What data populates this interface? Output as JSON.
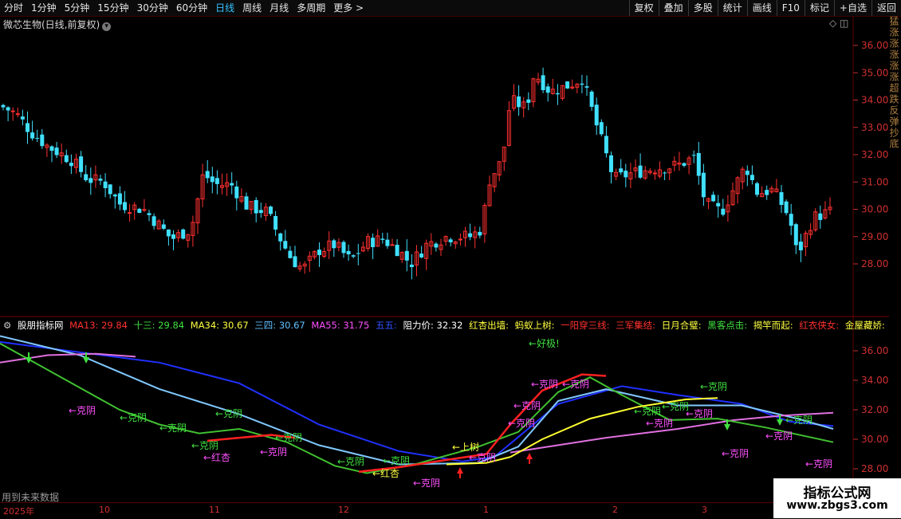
{
  "toolbar": {
    "periods": [
      "分时",
      "1分钟",
      "5分钟",
      "15分钟",
      "30分钟",
      "60分钟",
      "日线",
      "周线",
      "月线",
      "多周期",
      "更多 >"
    ],
    "active": "日线",
    "right_buttons": [
      "复权",
      "叠加",
      "多股",
      "统计",
      "画线",
      "F10",
      "标记",
      "+自选",
      "返回"
    ]
  },
  "stock_title": "微芯生物(日线,前复权)",
  "top_tools": "◇ ◫",
  "price_axis": [
    "36.00",
    "35.00",
    "34.00",
    "33.00",
    "32.00",
    "31.00",
    "30.00",
    "29.00",
    "28.00"
  ],
  "ind_axis": [
    "36.00",
    "34.00",
    "32.00",
    "30.00",
    "28.00"
  ],
  "indicator_legend": {
    "name": "股朋指标网",
    "items": [
      {
        "text": "MA13: 29.84",
        "color": "#ff3030"
      },
      {
        "text": "十三: 29.84",
        "color": "#40e040"
      },
      {
        "text": "MA34: 30.67",
        "color": "#ffff40"
      },
      {
        "text": "三四: 30.67",
        "color": "#60c0ff"
      },
      {
        "text": "MA55: 31.75",
        "color": "#ff50ff"
      },
      {
        "text": "五五:",
        "color": "#3050ff"
      },
      {
        "text": "阻力价: 32.32",
        "color": "#ffffff"
      },
      {
        "text": "红杏出墙:",
        "color": "#ffff40"
      },
      {
        "text": "蚂蚁上树:",
        "color": "#ffff40"
      },
      {
        "text": "一阳穿三线:",
        "color": "#ff3030"
      },
      {
        "text": "三军集结:",
        "color": "#ff3030"
      },
      {
        "text": "日月合璧:",
        "color": "#ffff40"
      },
      {
        "text": "黑客点击:",
        "color": "#40e040"
      },
      {
        "text": "揭竿而起:",
        "color": "#ffff40"
      },
      {
        "text": "红衣侠女:",
        "color": "#ff3030"
      },
      {
        "text": "金屋藏娇:",
        "color": "#ffff40"
      }
    ]
  },
  "annotations": [
    {
      "text": "←克阴",
      "color": "#ff50ff"
    },
    {
      "text": "←克阴",
      "color": "#40e040"
    },
    {
      "text": "←红杏",
      "color": "#ffff40"
    },
    {
      "text": "←上树",
      "color": "#ffff40"
    },
    {
      "text": "←好极!",
      "color": "#40e040"
    }
  ],
  "future_note": "用到未来数据",
  "dates": [
    "2025年",
    "10",
    "11",
    "12",
    "1",
    "2",
    "3"
  ],
  "right_strip": "猛涨涨涨涨涨超跌反弹抄底",
  "logo": {
    "line1": "指标公式网",
    "line2": "www.zbgs3.com"
  },
  "colors": {
    "up": "#ff3030",
    "down": "#40e0ff",
    "grid": "#5a0000"
  }
}
